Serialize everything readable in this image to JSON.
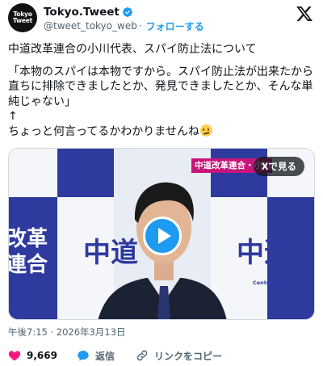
{
  "account": {
    "avatar_text_line1": "Tokyo",
    "avatar_text_line2": "Tweet",
    "display_name": "Tokyo.Tweet",
    "handle": "@tweet_tokyo_web",
    "separator": "·",
    "follow_label": "フォローする"
  },
  "tweet": {
    "line1": "中道改革連合の小川代表、スパイ防止法について",
    "line2": "「本物のスパイは本物ですから。スパイ防止法が出来たから直ちに排除できましたとか、発見できましたとか、そんな単純じゃない」\n↑\nちょっと何言ってるかわかりませんね"
  },
  "media": {
    "caption_chip": "中道改革連合・小川",
    "watch_on_x_label": "Xで見る",
    "backdrop_text_left": "改革\n連合",
    "backdrop_text_right": "中道改",
    "backdrop_sub": "Centrist Reform Allia",
    "backdrop_text_center": "中道"
  },
  "meta": {
    "timestamp": "午後7:15 · 2026年3月13日"
  },
  "actions": {
    "like_count": "9,669",
    "reply_label": "返信",
    "copy_link_label": "リンクをコピー"
  },
  "colors": {
    "accent": "#1d9bf0",
    "like": "#f91880",
    "backdrop_blue": "#2e3a9e"
  },
  "icons": {
    "verified": "verified-badge-icon",
    "x_logo": "x-logo-icon",
    "like": "heart-icon",
    "reply": "reply-bubble-icon",
    "link": "link-icon",
    "play": "play-icon"
  }
}
